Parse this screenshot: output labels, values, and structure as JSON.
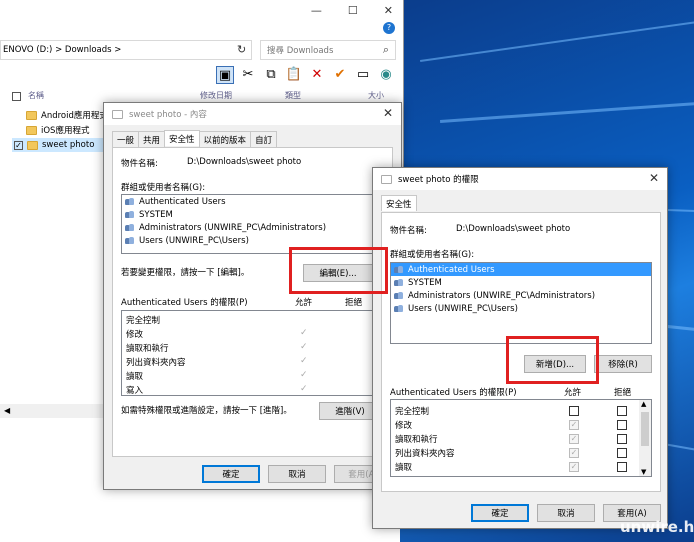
{
  "explorer": {
    "address": "ENOVO (D:)  >  Downloads  >",
    "search_placeholder": "搜尋 Downloads",
    "columns": {
      "name": "名稱",
      "modified": "修改日期",
      "type": "類型",
      "size": "大小"
    },
    "files": [
      {
        "name": "Android應用程式",
        "checked": false
      },
      {
        "name": "iOS應用程式",
        "checked": false
      },
      {
        "name": "sweet photo",
        "checked": true
      }
    ]
  },
  "props_dialog": {
    "title": "sweet photo - 內容",
    "tabs": [
      "一般",
      "共用",
      "安全性",
      "以前的版本",
      "自訂"
    ],
    "object_label": "物件名稱:",
    "object_value": "D:\\Downloads\\sweet photo",
    "group_label": "群組或使用者名稱(G):",
    "users": [
      "Authenticated Users",
      "SYSTEM",
      "Administrators (UNWIRE_PC\\Administrators)",
      "Users (UNWIRE_PC\\Users)"
    ],
    "change_hint": "若要變更權限，請按一下 [編輯]。",
    "edit_button": "編輯(E)...",
    "perm_label": "Authenticated Users 的權限(P)",
    "allow_header": "允許",
    "deny_header": "拒絕",
    "permissions": [
      "完全控制",
      "修改",
      "讀取和執行",
      "列出資料夾內容",
      "讀取",
      "寫入"
    ],
    "advanced_hint": "如需特殊權限或進階設定，請按一下 [進階]。",
    "advanced_button": "進階(V)",
    "ok": "確定",
    "cancel": "取消",
    "apply": "套用(A)"
  },
  "perm_dialog": {
    "title": "sweet photo 的權限",
    "tab": "安全性",
    "object_label": "物件名稱:",
    "object_value": "D:\\Downloads\\sweet photo",
    "group_label": "群組或使用者名稱(G):",
    "users": [
      "Authenticated Users",
      "SYSTEM",
      "Administrators (UNWIRE_PC\\Administrators)",
      "Users (UNWIRE_PC\\Users)"
    ],
    "add_button": "新增(D)...",
    "remove_button": "移除(R)",
    "perm_label": "Authenticated Users 的權限(P)",
    "allow_header": "允許",
    "deny_header": "拒絕",
    "permissions": [
      "完全控制",
      "修改",
      "讀取和執行",
      "列出資料夾內容",
      "讀取"
    ],
    "ok": "確定",
    "cancel": "取消",
    "apply": "套用(A)"
  },
  "watermark": "unwire.hk",
  "colors": {
    "highlight": "#3399ff",
    "red_box": "#e02020",
    "desktop": "#0a5fc2"
  }
}
